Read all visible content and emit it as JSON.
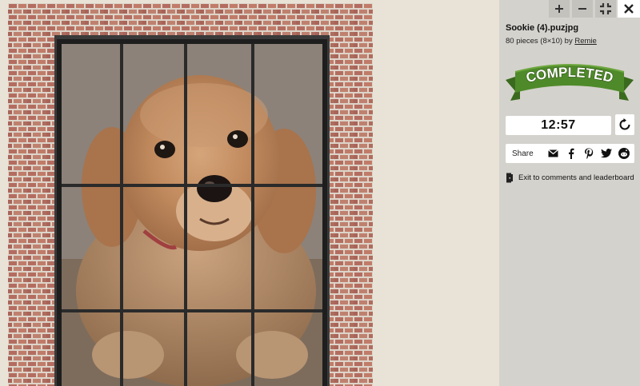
{
  "controls": {
    "zoom_in_icon": "plus-icon",
    "zoom_out_icon": "minus-icon",
    "exit_fullscreen_icon": "collapse-icon",
    "close_icon": "close-icon"
  },
  "puzzle": {
    "title": "Sookie (4).puzjpg",
    "pieces_text": "80 pieces (8×10) by ",
    "author": "Remie",
    "status_badge": "COMPLETED",
    "timer": "12:57",
    "colors": {
      "badge_green": "#4f8a2a",
      "badge_dark": "#3a6a1e",
      "sidebar_bg": "#d4d2cd",
      "canvas_bg": "#e8e3d6"
    }
  },
  "share": {
    "label": "Share",
    "icons": [
      "email-icon",
      "facebook-icon",
      "pinterest-icon",
      "twitter-icon",
      "reddit-icon"
    ]
  },
  "exit_link": {
    "label": "Exit to comments and leaderboard",
    "icon": "door-exit-icon"
  }
}
